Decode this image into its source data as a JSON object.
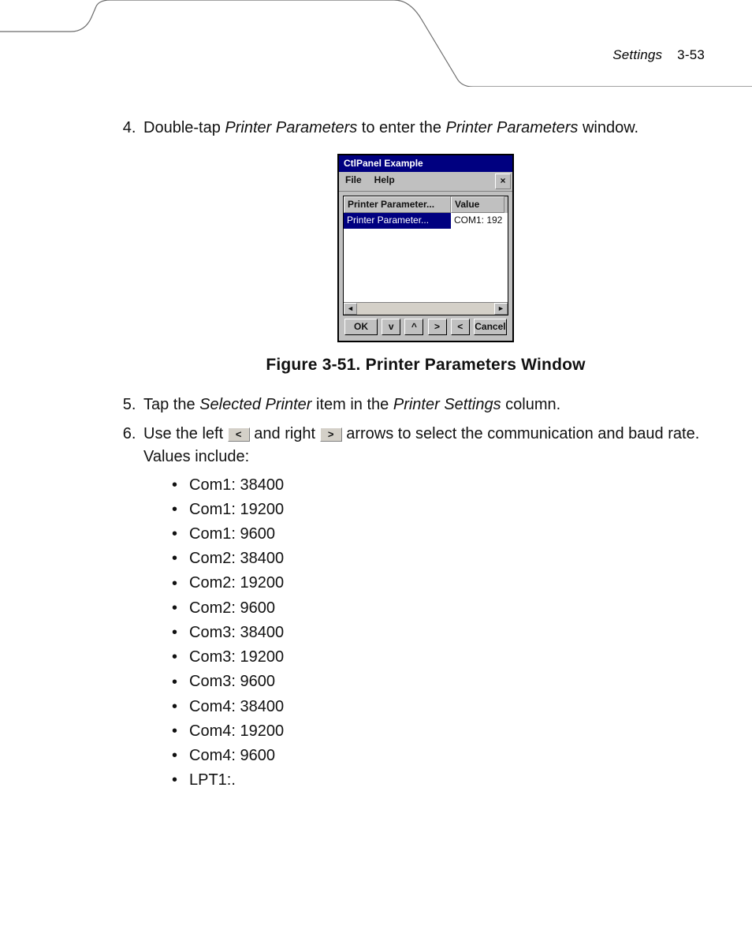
{
  "header": {
    "label": "Settings",
    "pageno": "3-53"
  },
  "steps": {
    "s4_pre": "Double-tap ",
    "s4_em1": "Printer Parameters",
    "s4_mid": " to enter the ",
    "s4_em2": "Printer Parameters",
    "s4_post": " window.",
    "s5_pre": "Tap the ",
    "s5_em1": "Selected Printer",
    "s5_mid": " item in the ",
    "s5_em2": "Printer Settings",
    "s5_post": " column.",
    "s6_pre": "Use the left ",
    "s6_left": "<",
    "s6_mid1": " and right ",
    "s6_right": ">",
    "s6_post": " arrows to select the communication and baud rate. Values include:"
  },
  "figure": {
    "caption": "Figure 3-51.  Printer Parameters Window"
  },
  "ctl": {
    "title": "CtlPanel Example",
    "menu_file": "File",
    "menu_help": "Help",
    "close": "×",
    "th_name": "Printer Parameter...",
    "th_value": "Value",
    "row_name": "Printer Parameter...",
    "row_value": "COM1: 192",
    "scroll_left": "◄",
    "scroll_right": "►",
    "btn_ok": "OK",
    "btn_down": "v",
    "btn_up": "^",
    "btn_next": ">",
    "btn_prev": "<",
    "btn_cancel": "Cancel"
  },
  "values": [
    "Com1: 38400",
    "Com1: 19200",
    "Com1: 9600",
    "Com2: 38400",
    "Com2: 19200",
    "Com2: 9600",
    "Com3: 38400",
    "Com3: 19200",
    "Com3: 9600",
    "Com4: 38400",
    "Com4: 19200",
    "Com4: 9600",
    "LPT1:."
  ]
}
